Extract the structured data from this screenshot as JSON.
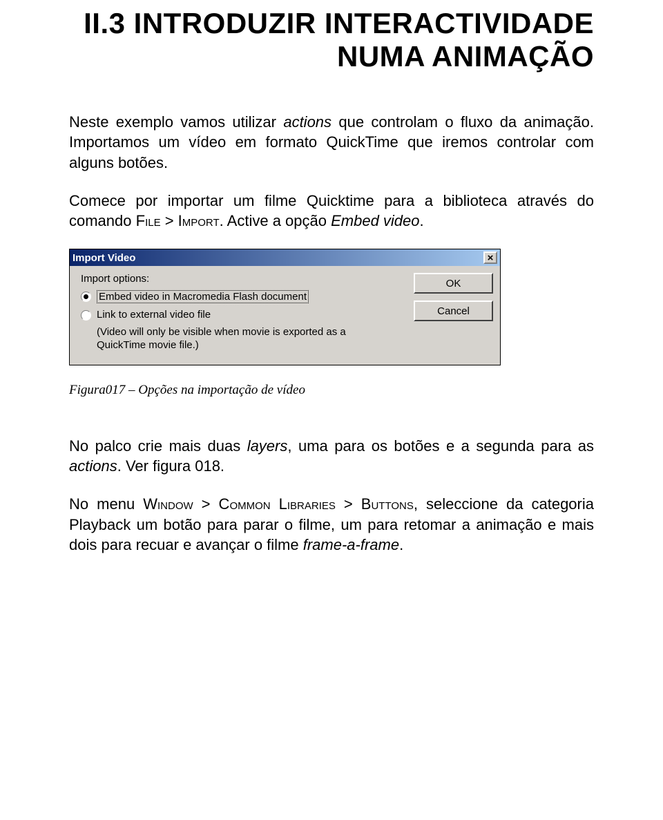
{
  "title_line1": "II.3  INTRODUZIR INTERACTIVIDADE",
  "title_line2": "NUMA ANIMAÇÃO",
  "para1_a": "Neste exemplo vamos utilizar ",
  "para1_it1": "actions",
  "para1_b": " que controlam o fluxo da animação. Importamos um vídeo em formato QuickTime que iremos controlar com alguns botões.",
  "para2_a": "Comece por importar um filme Quicktime para a biblioteca através do comando ",
  "para2_sc1": "File > Import",
  "para2_b": ". Active a opção ",
  "para2_it1": "Embed video",
  "para2_c": ".",
  "dialog": {
    "title": "Import Video",
    "close": "×",
    "options_label": "Import options:",
    "opt1": "Embed video in Macromedia Flash document",
    "opt2": "Link to external video file",
    "opt2_sub": "(Video will only be visible when movie is exported as a QuickTime movie file.)",
    "ok": "OK",
    "cancel": "Cancel"
  },
  "figcap": "Figura017 – Opções na importação de vídeo",
  "para3_a": "No palco crie mais duas ",
  "para3_it1": "layers",
  "para3_b": ", uma para os botões e a segunda para as ",
  "para3_it2": "actions",
  "para3_c": ". Ver figura 018.",
  "para4_a": "No menu ",
  "para4_sc1": "Window > Common Libraries > Buttons",
  "para4_b": ", seleccione da categoria Playback um botão para parar o filme, um para retomar a animação e mais dois para recuar e avançar o filme ",
  "para4_it1": "frame-a-frame",
  "para4_c": "."
}
